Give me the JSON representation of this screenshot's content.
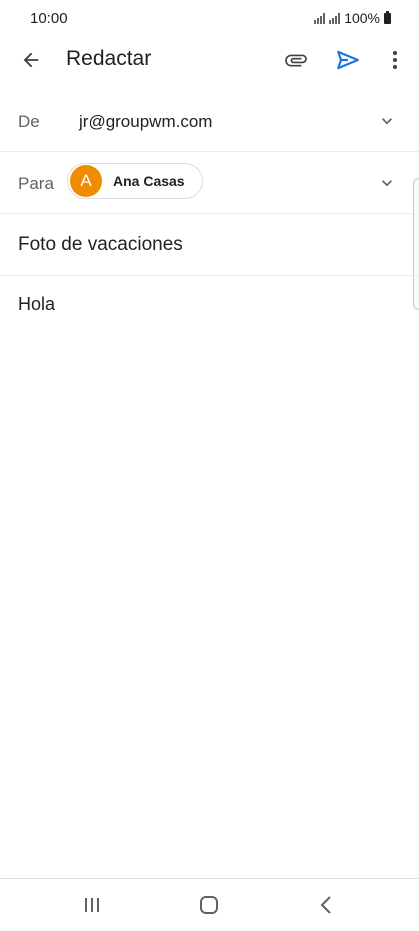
{
  "status_bar": {
    "time": "10:00",
    "battery": "100%"
  },
  "app_bar": {
    "title": "Redactar",
    "icons": [
      "back-arrow-icon",
      "paperclip-icon",
      "send-icon",
      "more-vert-icon"
    ],
    "send_color": "#1a73e8"
  },
  "from": {
    "label": "De",
    "value": "jr@groupwm.com"
  },
  "to": {
    "label": "Para",
    "recipients": [
      {
        "initial": "A",
        "name": "Ana Casas",
        "avatar_color": "#ef8c00"
      }
    ]
  },
  "subject": {
    "value": "Foto de vacaciones"
  },
  "body": {
    "value": "Hola"
  },
  "nav_bar": {
    "icons": [
      "recent-apps-icon",
      "home-icon",
      "back-icon"
    ]
  }
}
